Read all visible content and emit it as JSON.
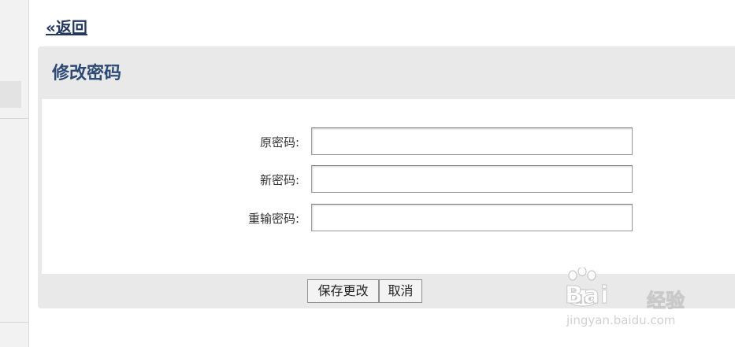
{
  "nav": {
    "back_label": "«返回"
  },
  "card": {
    "title": "修改密码",
    "fields": [
      {
        "label": "原密码:",
        "value": ""
      },
      {
        "label": "新密码:",
        "value": ""
      },
      {
        "label": "重输密码:",
        "value": ""
      }
    ],
    "buttons": {
      "save_label": "保存更改",
      "cancel_label": "取消"
    }
  },
  "watermark": {
    "brand": "Bai",
    "paw_text": "du",
    "suffix": "经验",
    "url": "jingyan.baidu.com"
  },
  "colors": {
    "title_blue": "#2d4a74",
    "link_blue": "#23385f",
    "panel_gray": "#e9e9e9"
  }
}
